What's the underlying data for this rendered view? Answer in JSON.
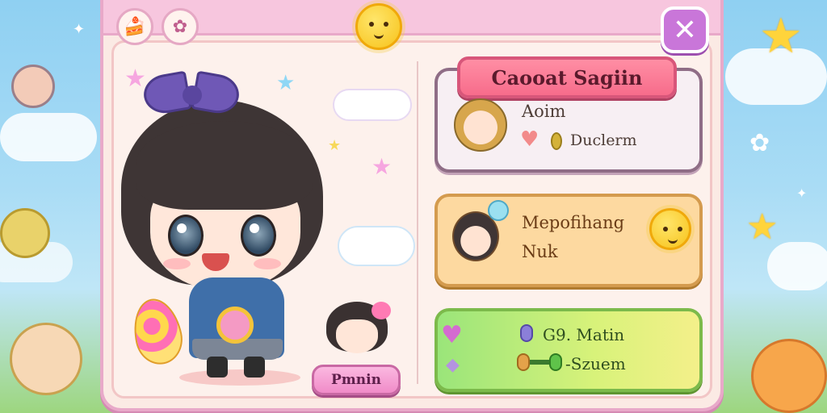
{
  "header": {
    "left_icons": [
      "cake-icon",
      "gift-icon"
    ],
    "center_icon": "sun-mascot-icon",
    "close_label": "✕"
  },
  "character": {
    "profile_button_label": "Pmnin"
  },
  "cards": {
    "profile": {
      "title": "Caooat Sagiin",
      "name": "Aoim",
      "status": "Duclerm"
    },
    "event": {
      "line1": "Mepofihang",
      "line2": "Nuk"
    },
    "stats": {
      "line1": "G9. Matin",
      "line2": "-Szuem"
    }
  },
  "colors": {
    "panel_border": "#e8a9c9",
    "title_pink": "#f76c8b",
    "event_orange": "#fdd9a0",
    "stats_green": "#9ae57a"
  }
}
